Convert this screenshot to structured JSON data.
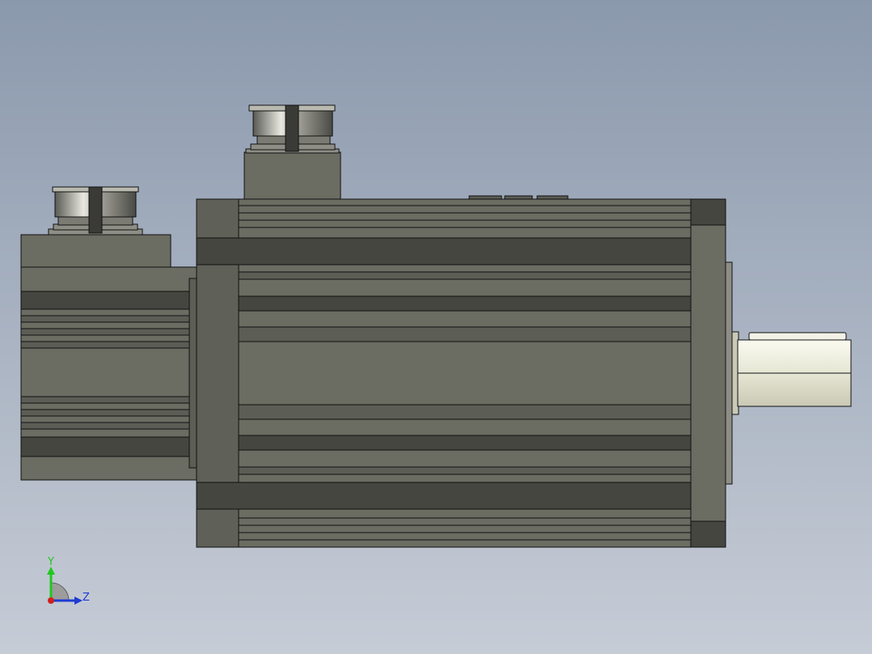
{
  "viewport": {
    "background_top_color": "#8b99ad",
    "background_bottom_color": "#c6ccd6"
  },
  "model": {
    "body_color": "#6b6c62",
    "body_dark_color": "#45463f",
    "edge_color": "#111111",
    "shaft_color": "#e6e6d4",
    "connector_color": "#8e8e86"
  },
  "triad": {
    "y_label": "Y",
    "z_label": "Z",
    "y_color": "#1ec81e",
    "z_color": "#1e3cd2",
    "x_color": "#d21e1e"
  }
}
